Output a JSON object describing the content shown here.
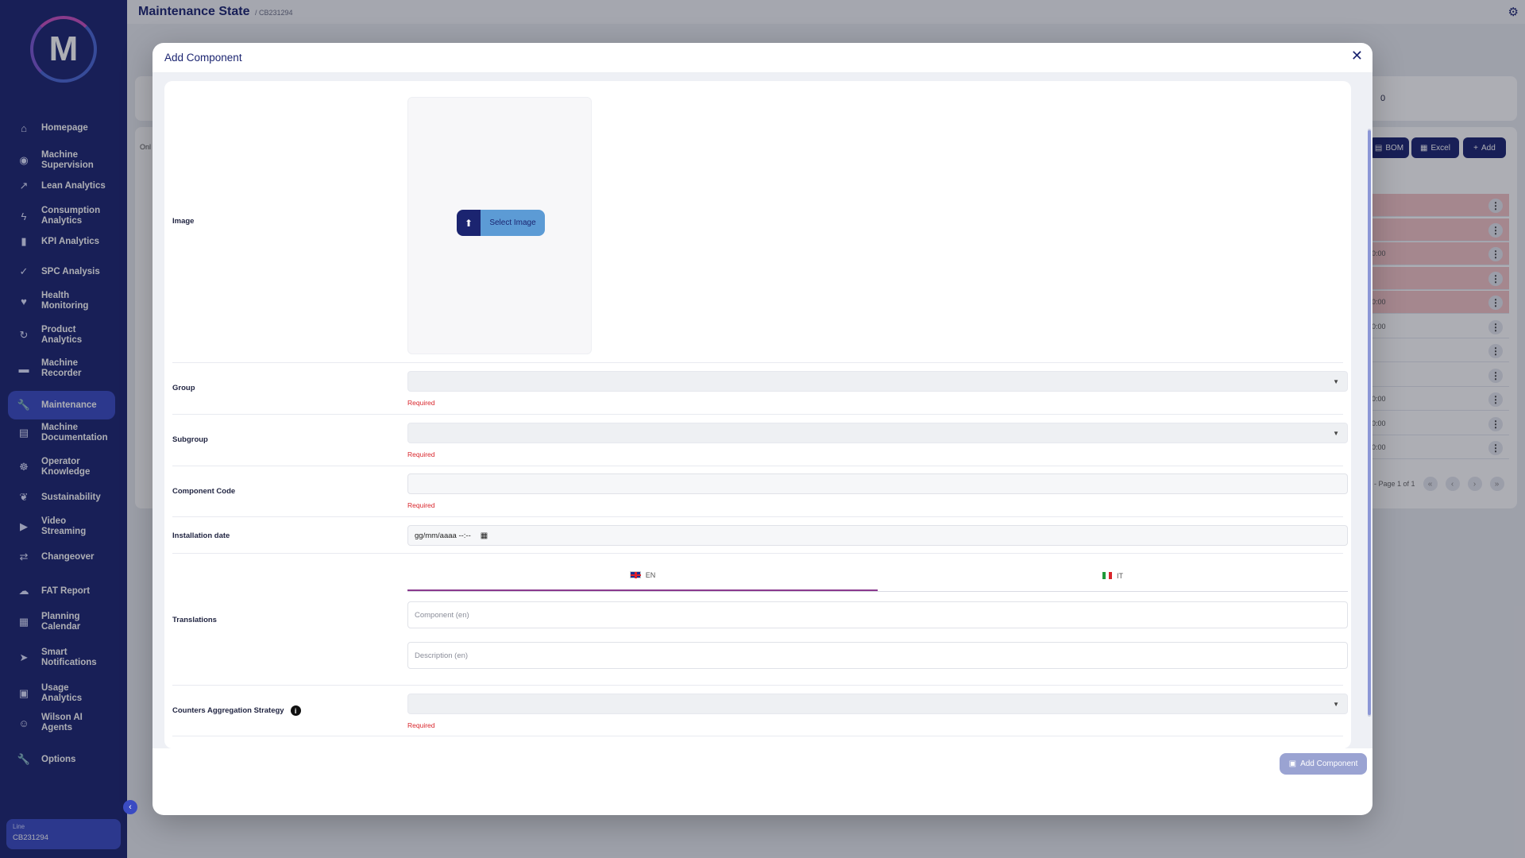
{
  "app": {
    "logo_letter": "M",
    "page_title": "Maintenance State",
    "page_subtitle": "/ CB231294"
  },
  "sidebar": {
    "items": [
      {
        "label": "Homepage",
        "icon": "home-icon",
        "glyph": "⌂"
      },
      {
        "label": "Machine Supervision",
        "icon": "eye-icon",
        "glyph": "◉"
      },
      {
        "label": "Lean Analytics",
        "icon": "trend-icon",
        "glyph": "↗"
      },
      {
        "label": "Consumption Analytics",
        "icon": "bolt-icon",
        "glyph": "ϟ"
      },
      {
        "label": "KPI Analytics",
        "icon": "bar-chart-icon",
        "glyph": "▮"
      },
      {
        "label": "SPC Analysis",
        "icon": "check-icon",
        "glyph": "✓"
      },
      {
        "label": "Health Monitoring",
        "icon": "heart-icon",
        "glyph": "♥"
      },
      {
        "label": "Product Analytics",
        "icon": "cycle-icon",
        "glyph": "↻"
      },
      {
        "label": "Machine Recorder",
        "icon": "recorder-icon",
        "glyph": "▬"
      },
      {
        "label": "Maintenance",
        "icon": "wrench-icon",
        "glyph": "🔧",
        "active": true
      },
      {
        "label": "Machine Documentation",
        "icon": "document-icon",
        "glyph": "▤"
      },
      {
        "label": "Operator Knowledge",
        "icon": "brain-icon",
        "glyph": "☸"
      },
      {
        "label": "Sustainability",
        "icon": "leaf-icon",
        "glyph": "❦"
      },
      {
        "label": "Video Streaming",
        "icon": "play-icon",
        "glyph": "▶"
      },
      {
        "label": "Changeover",
        "icon": "swap-icon",
        "glyph": "⇄"
      },
      {
        "label": "FAT Report",
        "icon": "cloud-icon",
        "glyph": "☁"
      },
      {
        "label": "Planning Calendar",
        "icon": "calendar-icon",
        "glyph": "▦"
      },
      {
        "label": "Smart Notifications",
        "icon": "send-icon",
        "glyph": "➤"
      },
      {
        "label": "Usage Analytics",
        "icon": "user-chart-icon",
        "glyph": "▣"
      },
      {
        "label": "Wilson AI Agents",
        "icon": "robot-icon",
        "glyph": "☺"
      },
      {
        "label": "Options",
        "icon": "options-wrench-icon",
        "glyph": "🔧"
      }
    ],
    "line_label": "Line",
    "line_value": "CB231294"
  },
  "background": {
    "card_value": "0",
    "filter_text": "Onl",
    "bom_label": "BOM",
    "excel_label": "Excel",
    "add_label": "Add",
    "rows": [
      {
        "text": "",
        "red": true
      },
      {
        "text": "",
        "red": true
      },
      {
        "text": "0:00",
        "red": true
      },
      {
        "text": "",
        "red": true
      },
      {
        "text": "0:00",
        "red": true
      },
      {
        "text": "0:00",
        "red": false
      },
      {
        "text": "",
        "red": false
      },
      {
        "text": "",
        "red": false
      },
      {
        "text": "0:00",
        "red": false
      },
      {
        "text": "0:00",
        "red": false
      },
      {
        "text": "0:00",
        "red": false
      }
    ],
    "pager_text": "- Page 1 of 1"
  },
  "modal": {
    "title": "Add Component",
    "image_label": "Image",
    "select_image_label": "Select Image",
    "group_label": "Group",
    "subgroup_label": "Subgroup",
    "component_code_label": "Component Code",
    "installation_date_label": "Installation date",
    "installation_date_value": "gg/mm/aaaa --:--",
    "translations_label": "Translations",
    "tab_en": "EN",
    "tab_it": "IT",
    "component_placeholder": "Component (en)",
    "description_placeholder": "Description (en)",
    "counters_label": "Counters Aggregation Strategy",
    "required_text": "Required",
    "submit_label": "Add Component"
  },
  "colors": {
    "sidebar_bg": "#1b2470",
    "active_item": "#3a4bc3",
    "required": "#d9262c",
    "tab_underline": "#8a3a8e"
  }
}
